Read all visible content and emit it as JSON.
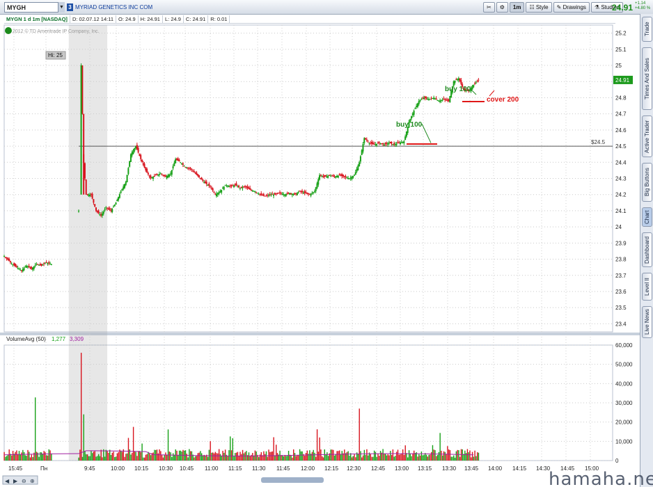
{
  "toolbar": {
    "symbol": "MYGH",
    "link_group": "3",
    "company_name": "MYRIAD GENETICS INC COM",
    "aggregation": "1m",
    "style_label": "Style",
    "drawings_label": "Drawings",
    "studies_label": "Studies",
    "last_price": "24.91",
    "net_change": "+1.14",
    "pct_change": "+4.80 %"
  },
  "info_bar": {
    "symbol_label": "MYGN 1 d 1m [NASDAQ]",
    "date": "D: 02.07.12 14:11",
    "open": "O: 24.9",
    "high": "H: 24.91",
    "low": "L: 24.9",
    "close": "C: 24.91",
    "range": "R: 0.01"
  },
  "copyright": "2012 © TD Ameritrade IP Company, Inc.",
  "volume_header": {
    "study": "VolumeAvg (50)",
    "volume": "1,277",
    "avg": "3,309"
  },
  "side_tabs": [
    "Trade",
    "Times And Sales",
    "Active Trader",
    "Big Buttons",
    "Chart",
    "Dashboard",
    "Level II",
    "Live News"
  ],
  "active_tab": "Chart",
  "watermark": "hamaha.net",
  "colors": {
    "up": "#16a016",
    "down": "#d8141e",
    "avg": "#a020a0",
    "annot": "#1f8a1f",
    "cover": "#e01818",
    "price_bg": "#1c9a1c"
  },
  "chart_data": {
    "type": "candlestick",
    "price_axis": {
      "ticks": [
        23.4,
        23.5,
        23.6,
        23.7,
        23.8,
        23.9,
        24,
        24.1,
        24.2,
        24.3,
        24.4,
        24.5,
        24.6,
        24.7,
        24.8,
        24.9,
        25,
        25.1,
        25.2
      ],
      "range": [
        23.35,
        25.25
      ]
    },
    "volume_axis": {
      "ticks": [
        "0",
        "10,000",
        "20,000",
        "30,000",
        "40,000",
        "50,000",
        "60,000"
      ],
      "range": [
        0,
        60000
      ]
    },
    "time_axis": [
      "15:45",
      "Пн",
      "9:45",
      "10:00",
      "10:15",
      "10:30",
      "10:45",
      "11:00",
      "11:15",
      "11:30",
      "11:45",
      "12:00",
      "12:15",
      "12:30",
      "12:45",
      "13:00",
      "13:15",
      "13:30",
      "13:45",
      "14:00",
      "14:15",
      "14:30",
      "14:45",
      "15:00"
    ],
    "price_path": [
      [
        0,
        23.82
      ],
      [
        5,
        23.78
      ],
      [
        10,
        23.75
      ],
      [
        14,
        23.73
      ],
      [
        18,
        23.76
      ],
      [
        22,
        23.74
      ],
      [
        26,
        23.77
      ],
      [
        30,
        23.76
      ],
      [
        34,
        23.78
      ],
      [
        38,
        23.77
      ],
      [
        60,
        24.1
      ],
      [
        62,
        25.0
      ],
      [
        64,
        24.4
      ],
      [
        66,
        24.2
      ],
      [
        70,
        24.2
      ],
      [
        74,
        24.1
      ],
      [
        78,
        24.07
      ],
      [
        82,
        24.12
      ],
      [
        86,
        24.1
      ],
      [
        90,
        24.15
      ],
      [
        94,
        24.22
      ],
      [
        98,
        24.28
      ],
      [
        102,
        24.45
      ],
      [
        106,
        24.5
      ],
      [
        110,
        24.42
      ],
      [
        114,
        24.35
      ],
      [
        118,
        24.3
      ],
      [
        122,
        24.32
      ],
      [
        126,
        24.33
      ],
      [
        130,
        24.31
      ],
      [
        134,
        24.33
      ],
      [
        138,
        24.42
      ],
      [
        142,
        24.4
      ],
      [
        146,
        24.37
      ],
      [
        150,
        24.36
      ],
      [
        154,
        24.33
      ],
      [
        158,
        24.3
      ],
      [
        162,
        24.27
      ],
      [
        166,
        24.25
      ],
      [
        170,
        24.2
      ],
      [
        174,
        24.22
      ],
      [
        178,
        24.26
      ],
      [
        182,
        24.25
      ],
      [
        186,
        24.26
      ],
      [
        190,
        24.24
      ],
      [
        194,
        24.25
      ],
      [
        198,
        24.23
      ],
      [
        202,
        24.22
      ],
      [
        206,
        24.2
      ],
      [
        210,
        24.19
      ],
      [
        214,
        24.2
      ],
      [
        218,
        24.2
      ],
      [
        222,
        24.21
      ],
      [
        226,
        24.2
      ],
      [
        230,
        24.21
      ],
      [
        234,
        24.2
      ],
      [
        238,
        24.22
      ],
      [
        242,
        24.21
      ],
      [
        246,
        24.2
      ],
      [
        250,
        24.22
      ],
      [
        254,
        24.32
      ],
      [
        258,
        24.31
      ],
      [
        262,
        24.32
      ],
      [
        266,
        24.31
      ],
      [
        270,
        24.32
      ],
      [
        274,
        24.31
      ],
      [
        278,
        24.3
      ],
      [
        282,
        24.32
      ],
      [
        286,
        24.4
      ],
      [
        290,
        24.55
      ],
      [
        294,
        24.52
      ],
      [
        298,
        24.51
      ],
      [
        302,
        24.52
      ],
      [
        306,
        24.51
      ],
      [
        310,
        24.52
      ],
      [
        314,
        24.51
      ],
      [
        318,
        24.52
      ],
      [
        322,
        24.53
      ],
      [
        326,
        24.65
      ],
      [
        330,
        24.72
      ],
      [
        334,
        24.78
      ],
      [
        338,
        24.8
      ],
      [
        342,
        24.79
      ],
      [
        346,
        24.8
      ],
      [
        350,
        24.78
      ],
      [
        354,
        24.79
      ],
      [
        358,
        24.78
      ],
      [
        362,
        24.9
      ],
      [
        366,
        24.92
      ],
      [
        370,
        24.85
      ],
      [
        374,
        24.84
      ],
      [
        378,
        24.88
      ],
      [
        382,
        24.91
      ]
    ],
    "reference_line": {
      "value": 24.5,
      "label": "$24.5"
    },
    "hi_label": "Hi: 25",
    "last_price_label": "24.91",
    "annotations": [
      {
        "text": "buy 100",
        "type": "buy",
        "price": 24.52
      },
      {
        "text": "buy 100",
        "type": "buy",
        "price": 24.79
      },
      {
        "text": "cover 200",
        "type": "cover",
        "price": 24.84
      }
    ]
  }
}
